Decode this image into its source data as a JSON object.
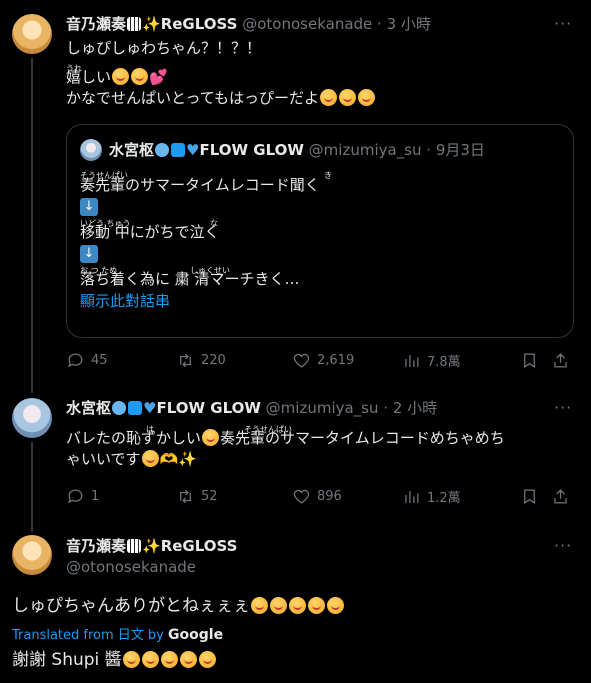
{
  "tweet1": {
    "name": "音乃瀬奏",
    "badges_text": "ReGLOSS",
    "handle": "@otonosekanade",
    "time": "· 3 小時",
    "line1": "しゅぴしゅわちゃん？！？！",
    "ruby_ure": "うれ",
    "line2": "嬉しい",
    "line3": "かなでせんぱいとってもはっぴーだよ",
    "stats": {
      "replies": "45",
      "retweets": "220",
      "likes": "2,619",
      "views": "7.8萬"
    }
  },
  "quote": {
    "name": "水宮枢",
    "badges_text": "FLOW GLOW",
    "handle": "@mizumiya_su",
    "time": "· 9月3日",
    "ruby1": "そうせんぱい",
    "ruby1b": "き",
    "line1": "奏先輩のサマータイムレコード聞く",
    "ruby2": "いどう ちゅう",
    "ruby2b": "な",
    "line2": "移動 中にがちで泣く",
    "ruby3": "お  つ  ため",
    "ruby3b": "しゅくせい",
    "line3": "落ち着く為に 粛 清マーチきく…",
    "show_thread": "顯示此對話串"
  },
  "tweet2": {
    "name": "水宮枢",
    "badges_text": "FLOW GLOW",
    "handle": "@mizumiya_su",
    "time": "· 2 小時",
    "ruby_ha": "は",
    "ruby_sou": "そうせんぱい",
    "line1": "バレたの恥ずかしい",
    "line1b": "奏先輩のサマータイムレコードめちゃめち",
    "line2": "ゃいいです",
    "stats": {
      "replies": "1",
      "retweets": "52",
      "likes": "896",
      "views": "1.2萬"
    }
  },
  "tweet3": {
    "name": "音乃瀬奏",
    "badges_text": "ReGLOSS",
    "handle": "@otonosekanade",
    "text": "しゅぴちゃんありがとねぇぇぇ",
    "translated_prefix": "Translated from 日文 by",
    "translator": "Google",
    "translation": "謝謝 Shupi 醬"
  },
  "icons": [
    "reply-icon",
    "retweet-icon",
    "like-icon",
    "views-icon",
    "bookmark-icon",
    "share-icon",
    "more-icon"
  ]
}
